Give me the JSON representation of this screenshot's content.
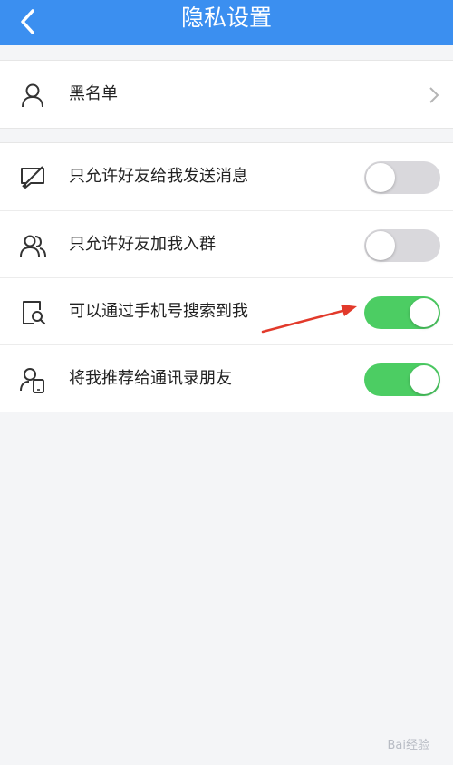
{
  "header": {
    "title": "隐私设置"
  },
  "blacklist": {
    "label": "黑名单"
  },
  "settings": [
    {
      "label": "只允许好友给我发送消息",
      "on": false
    },
    {
      "label": "只允许好友加我入群",
      "on": false
    },
    {
      "label": "可以通过手机号搜索到我",
      "on": true
    },
    {
      "label": "将我推荐给通讯录朋友",
      "on": true
    }
  ],
  "icons": {
    "back": "chevron-left-icon",
    "blacklist": "person-icon",
    "messages": "message-blocked-icon",
    "groups": "people-icon",
    "phone_search": "search-phone-icon",
    "contacts": "person-phone-icon"
  },
  "colors": {
    "header": "#3b8ff0",
    "toggle_on": "#4ccd63",
    "toggle_off": "#d9d8dc",
    "annotation": "#e23a2b"
  },
  "watermark": {
    "text": "Bai经验"
  }
}
